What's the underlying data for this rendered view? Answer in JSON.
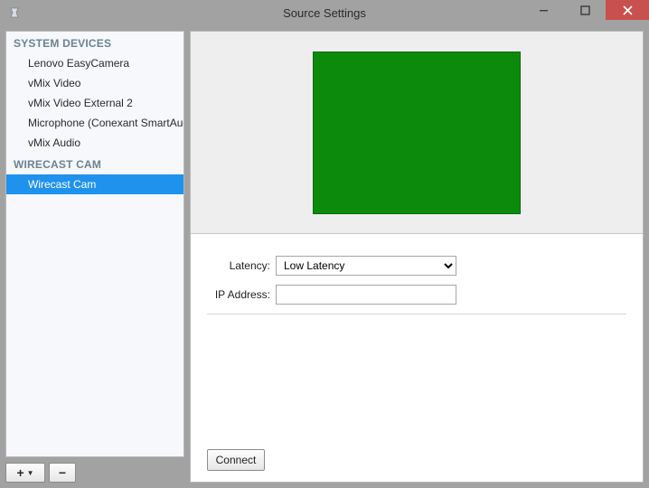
{
  "window": {
    "title": "Source Settings"
  },
  "sidebar": {
    "sections": [
      {
        "label": "SYSTEM DEVICES",
        "items": [
          {
            "label": "Lenovo EasyCamera",
            "selected": false
          },
          {
            "label": "vMix Video",
            "selected": false
          },
          {
            "label": "vMix Video External 2",
            "selected": false
          },
          {
            "label": "Microphone (Conexant SmartAudio",
            "selected": false
          },
          {
            "label": "vMix Audio",
            "selected": false
          }
        ]
      },
      {
        "label": "WIRECAST CAM",
        "items": [
          {
            "label": "Wirecast Cam",
            "selected": true
          }
        ]
      }
    ],
    "add_label": "+",
    "remove_label": "−"
  },
  "preview": {
    "color": "#0c8a0c"
  },
  "settings": {
    "latency_label": "Latency:",
    "latency_value": "Low Latency",
    "latency_options": [
      "Low Latency"
    ],
    "ip_label": "IP Address:",
    "ip_value": "",
    "connect_label": "Connect"
  }
}
